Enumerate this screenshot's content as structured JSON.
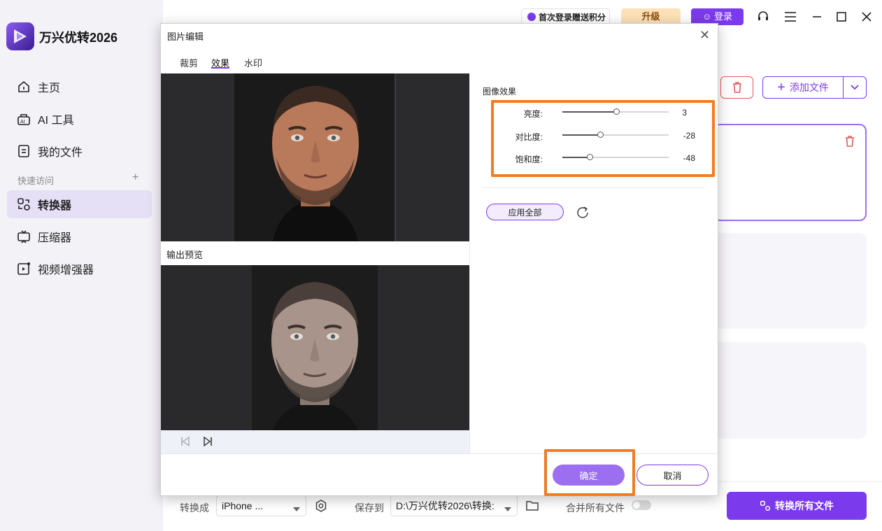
{
  "app": {
    "title": "万兴优转2026"
  },
  "sidebar": {
    "items": [
      {
        "label": "主页",
        "icon": "home-icon"
      },
      {
        "label": "AI 工具",
        "icon": "ai-tools-icon"
      },
      {
        "label": "我的文件",
        "icon": "my-files-icon"
      }
    ],
    "quick_access_label": "快速访问",
    "quick_items": [
      {
        "label": "转换器",
        "icon": "converter-icon",
        "active": true
      },
      {
        "label": "压缩器",
        "icon": "compressor-icon"
      },
      {
        "label": "视频增强器",
        "icon": "video-enhancer-icon"
      }
    ]
  },
  "topbar": {
    "promo": "首次登录赠送积分",
    "upgrade": "升级",
    "login": "登录"
  },
  "main": {
    "add_file": "添加文件"
  },
  "bottom": {
    "convert_to_label": "转换成",
    "convert_to_value": "iPhone ...",
    "save_to_label": "保存到",
    "save_to_value": "D:\\万兴优转2026\\转换:",
    "merge_label": "合并所有文件",
    "convert_all": "转换所有文件"
  },
  "dialog": {
    "title": "图片编辑",
    "tabs": [
      "裁剪",
      "效果",
      "水印"
    ],
    "active_tab": "效果",
    "output_preview": "输出预览",
    "section_title": "图像效果",
    "sliders": [
      {
        "label": "亮度:",
        "value": "3",
        "fraction": 0.52
      },
      {
        "label": "对比度:",
        "value": "-28",
        "fraction": 0.36
      },
      {
        "label": "饱和度:",
        "value": "-48",
        "fraction": 0.26
      }
    ],
    "apply_all": "应用全部",
    "ok": "确定",
    "cancel": "取消"
  },
  "colors": {
    "accent": "#7c3aed",
    "highlight": "#f47b20",
    "danger": "#e45b5b"
  }
}
